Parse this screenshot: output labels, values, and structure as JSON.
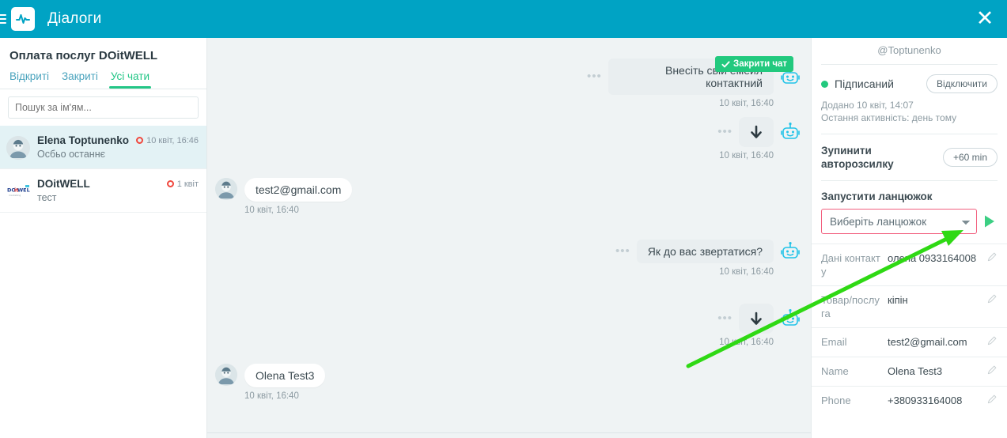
{
  "header": {
    "title": "Діалоги",
    "menu_icon": "hamburger-icon",
    "logo_icon": "pulse-logo-icon",
    "close_label": "✕"
  },
  "sidebar": {
    "title": "Оплата послуг DOitWELL",
    "tabs": [
      {
        "label": "Відкриті",
        "active": false
      },
      {
        "label": "Закриті",
        "active": false
      },
      {
        "label": "Усі чати",
        "active": true
      }
    ],
    "search": {
      "placeholder": "Пошук за ім'ям...",
      "value": ""
    },
    "chats": [
      {
        "name": "Elena Toptunenko",
        "preview": "Осбьо останнє",
        "time": "10 квіт, 16:46",
        "unread_icon": "unread-circle-icon",
        "selected": true,
        "avatar": "person-avatar"
      },
      {
        "name": "DOitWELL",
        "preview": "тест",
        "time": "1 квіт",
        "unread_icon": "unread-circle-icon",
        "selected": false,
        "avatar": "doitwell-logo-avatar"
      }
    ]
  },
  "chat": {
    "close_chat_label": "Закрити чат",
    "close_chat_icon": "check-icon",
    "messages": [
      {
        "direction": "out",
        "text": "Внесіть свій емейл контактний",
        "time": "10 квіт, 16:40",
        "sender_icon": "bot-icon",
        "menu_icon": "ellipsis-icon"
      },
      {
        "direction": "out",
        "text": "",
        "attachment_icon": "download-arrow-icon",
        "time": "10 квіт, 16:40",
        "sender_icon": "bot-icon",
        "menu_icon": "ellipsis-icon"
      },
      {
        "direction": "in",
        "text": "test2@gmail.com",
        "time": "10 квіт, 16:40",
        "sender_icon": "person-avatar"
      },
      {
        "direction": "out",
        "text": "Як до вас звертатися?",
        "time": "10 квіт, 16:40",
        "sender_icon": "bot-icon",
        "menu_icon": "ellipsis-icon"
      },
      {
        "direction": "out",
        "text": "",
        "attachment_icon": "download-arrow-icon",
        "time": "10 квіт, 16:40",
        "sender_icon": "bot-icon",
        "menu_icon": "ellipsis-icon"
      },
      {
        "direction": "in",
        "text": "Olena Test3",
        "time": "10 квіт, 16:40",
        "sender_icon": "person-avatar"
      }
    ]
  },
  "contact_panel": {
    "handle": "@Toptunenko",
    "status_label": "Підписаний",
    "status_dot_color": "#22c97e",
    "unsubscribe_label": "Відключити",
    "added_line": "Додано 10 квіт, 14:07",
    "last_activity_line": "Остання активність: день тому",
    "stop_autosend_label": "Зупинити авторозсилку",
    "stop_autosend_button": "+60 min",
    "chain_title": "Запустити ланцюжок",
    "chain_select_value": "Виберіть ланцюжок",
    "chain_select_options": [
      "Виберіть ланцюжок"
    ],
    "chain_play_icon": "play-icon",
    "fields": [
      {
        "label": "Дані контакту",
        "value": "олена 0933164008",
        "edit_icon": "pencil-icon"
      },
      {
        "label": "Товар/послуга",
        "value": "кіпін",
        "edit_icon": "pencil-icon"
      },
      {
        "label": "Email",
        "value": "test2@gmail.com",
        "edit_icon": "pencil-icon"
      },
      {
        "label": "Name",
        "value": "Olena Test3",
        "edit_icon": "pencil-icon"
      },
      {
        "label": "Phone",
        "value": "+380933164008",
        "edit_icon": "pencil-icon"
      }
    ]
  },
  "annotation": {
    "arrow_color": "#2fd914",
    "points_to": "chain-select"
  },
  "theme": {
    "header_bg": "#00a3c4",
    "accent_green": "#22c97e",
    "chat_bg": "#eff3f4",
    "highlight_border": "#f2607f"
  }
}
